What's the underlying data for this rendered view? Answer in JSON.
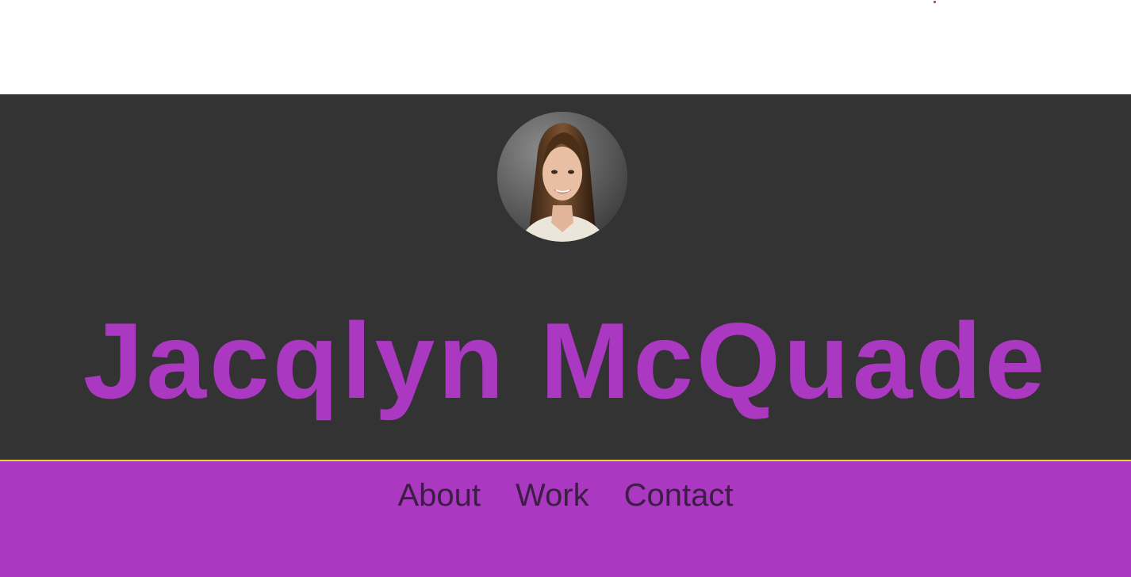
{
  "header": {
    "name": "Jacqlyn McQuade"
  },
  "nav": {
    "items": [
      {
        "label": "About"
      },
      {
        "label": "Work"
      },
      {
        "label": "Contact"
      }
    ]
  },
  "colors": {
    "hero_bg": "#333333",
    "accent": "#aa38c0",
    "divider": "#e8d23a",
    "nav_text": "#3a1f42",
    "page_bg": "#ffffff"
  },
  "icons": {
    "avatar": "profile-photo"
  }
}
